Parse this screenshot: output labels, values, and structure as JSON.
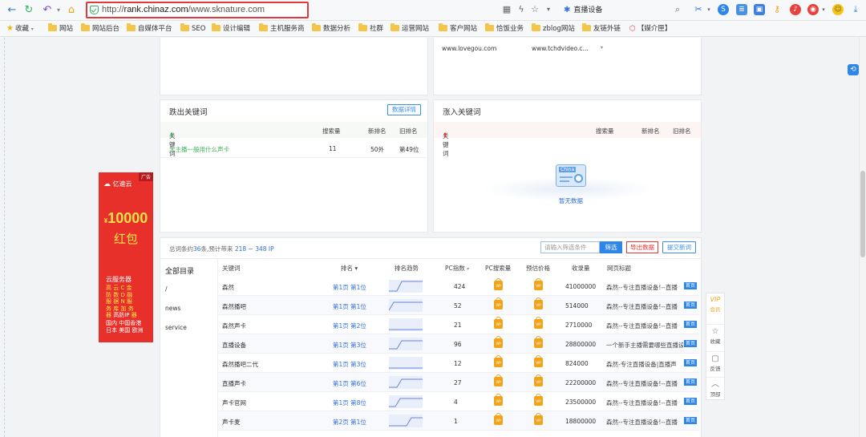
{
  "browser": {
    "url_prefix": "http://",
    "url_domain": "rank.chinaz.com",
    "url_path": "/www.sknature.com",
    "search_query": "直播设备"
  },
  "bookmarks": [
    "收藏",
    "网站",
    "网站后台",
    "自媒体平台",
    "SEO",
    "设计编辑",
    "主机服务商",
    "数据分析",
    "社群",
    "运营网站",
    "客户网站",
    "恰饭业务",
    "zblog网站",
    "友链外链",
    "【媒介匣】"
  ],
  "top_card_links": [
    "www.lovegou.com",
    "www.tchdvideo.c..."
  ],
  "out_card": {
    "title": "跌出关键词",
    "detail_button": "数据详情",
    "headers": [
      "关键词",
      "搜索量",
      "新排名",
      "旧排名"
    ],
    "rows": [
      {
        "keyword": "大主播一般用什么声卡",
        "volume": "11",
        "new_rank": "50外",
        "old_rank": "第49位"
      }
    ]
  },
  "in_card": {
    "title": "涨入关键词",
    "headers": [
      "关键词",
      "搜索量",
      "新排名",
      "旧排名"
    ],
    "empty_text": "暂无数据",
    "empty_logo": "China"
  },
  "ad": {
    "tag": "广告",
    "brand": "亿速云",
    "amount": "10000",
    "amount_prefix": "¥",
    "word": "红包",
    "service": "云服务器",
    "grid": [
      "高",
      "云",
      "C",
      "金",
      "防",
      "数",
      "D",
      "融",
      "服",
      "据",
      "N",
      "服",
      "务",
      "库",
      "加",
      "务",
      "器",
      "",
      "速",
      "器"
    ],
    "line1": "高防IP",
    "line2": "国内 中国香港",
    "line3": "日本 美国 欧洲"
  },
  "table": {
    "summary_prefix": "总词条约",
    "summary_count": "36",
    "summary_mid": "条,预计带来",
    "summary_range": "218 ~ 348 IP",
    "search_placeholder": "请输入筛选条件",
    "filter_button": "筛选",
    "export_button": "导出数据",
    "submit_button": "提交新词",
    "dir_title": "全部目录",
    "dirs": [
      "/",
      "news",
      "service"
    ],
    "headers": [
      "关键词",
      "排名",
      "排名趋势",
      "PC指数",
      "PC搜索量",
      "预估价格",
      "收录量",
      "网页标题"
    ],
    "rank_arrow": "▾",
    "home_badge": "首页",
    "rows": [
      {
        "keyword": "森然",
        "rank": "第1页 第1位",
        "pc_index": "424",
        "included": "41000000",
        "title": "森然--专注直播设备!--直播"
      },
      {
        "keyword": "森然播吧",
        "rank": "第1页 第1位",
        "pc_index": "52",
        "included": "514000",
        "title": "森然--专注直播设备!--直播"
      },
      {
        "keyword": "森然声卡",
        "rank": "第1页 第2位",
        "pc_index": "21",
        "included": "2710000",
        "title": "森然--专注直播设备!--直播"
      },
      {
        "keyword": "直播设备",
        "rank": "第1页 第3位",
        "pc_index": "96",
        "included": "28800000",
        "title": "一个新手主播需要哪些直播设"
      },
      {
        "keyword": "森然播吧二代",
        "rank": "第1页 第3位",
        "pc_index": "12",
        "included": "824000",
        "title": "森然-专注直播设备|直播声"
      },
      {
        "keyword": "直播声卡",
        "rank": "第1页 第6位",
        "pc_index": "27",
        "included": "22200000",
        "title": "森然--专注直播设备!--直播"
      },
      {
        "keyword": "声卡官网",
        "rank": "第1页 第8位",
        "pc_index": "4",
        "included": "23500000",
        "title": "森然--专注直播设备!--直播"
      },
      {
        "keyword": "声卡麦",
        "rank": "第2页 第1位",
        "pc_index": "1",
        "included": "18800000",
        "title": "森然--专注直播设备!--直播"
      }
    ]
  },
  "float_bar": {
    "vip": "VIP",
    "member": "会员",
    "favorite": "收藏",
    "feedback": "反馈",
    "top": "顶部"
  }
}
